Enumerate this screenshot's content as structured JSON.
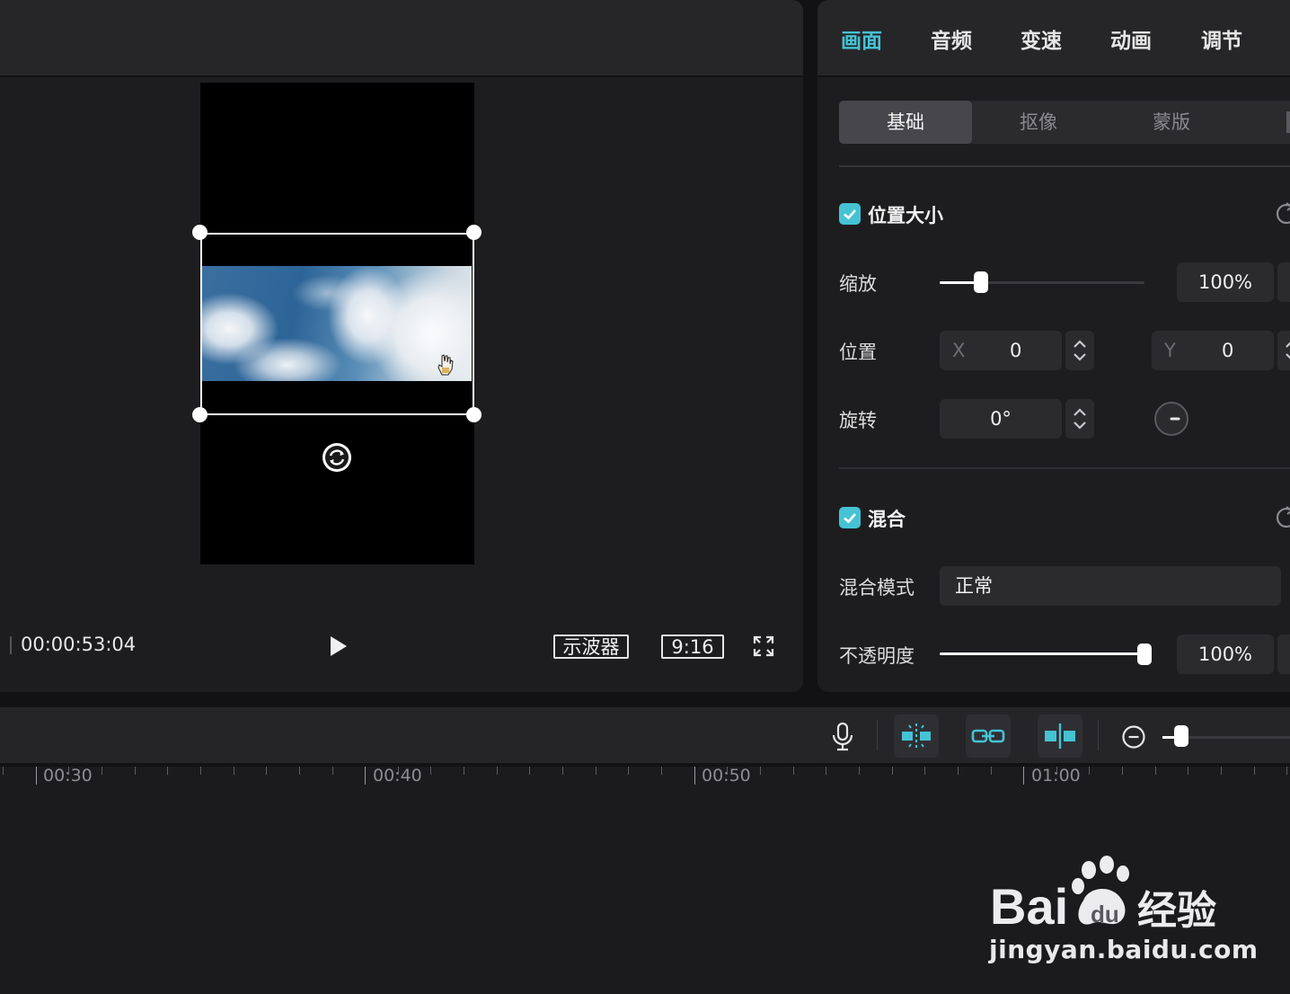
{
  "player": {
    "timecode": "00:00:53:04",
    "scope_label": "示波器",
    "ratio_label": "9:16"
  },
  "panel": {
    "tabs": [
      {
        "label": "画面",
        "active": true
      },
      {
        "label": "音频",
        "active": false
      },
      {
        "label": "变速",
        "active": false
      },
      {
        "label": "动画",
        "active": false
      },
      {
        "label": "调节",
        "active": false
      }
    ],
    "subtabs": [
      {
        "label": "基础",
        "active": true
      },
      {
        "label": "抠像",
        "active": false
      },
      {
        "label": "蒙版",
        "active": false
      }
    ],
    "position_size": {
      "title": "位置大小",
      "checked": true,
      "scale_label": "缩放",
      "scale_value": "100%",
      "scale_level": 0.2,
      "position_label": "位置",
      "x_axis": "X",
      "x_value": "0",
      "y_axis": "Y",
      "y_value": "0",
      "rotation_label": "旋转",
      "rotation_value": "0°"
    },
    "blend": {
      "title": "混合",
      "checked": true,
      "mode_label": "混合模式",
      "mode_value": "正常",
      "opacity_label": "不透明度",
      "opacity_value": "100%",
      "opacity_level": 1.0
    }
  },
  "timeline": {
    "ruler_labels": [
      "00:30",
      "00:40",
      "00:50",
      "01:00"
    ],
    "zoom_level": 0.15
  },
  "watermark": {
    "brand_latin": "Bai",
    "brand_cn": "经验",
    "url": "jingyan.baidu.com"
  },
  "colors": {
    "accent": "#45c3d4",
    "background": "#1d1d1f",
    "header": "#262629"
  }
}
